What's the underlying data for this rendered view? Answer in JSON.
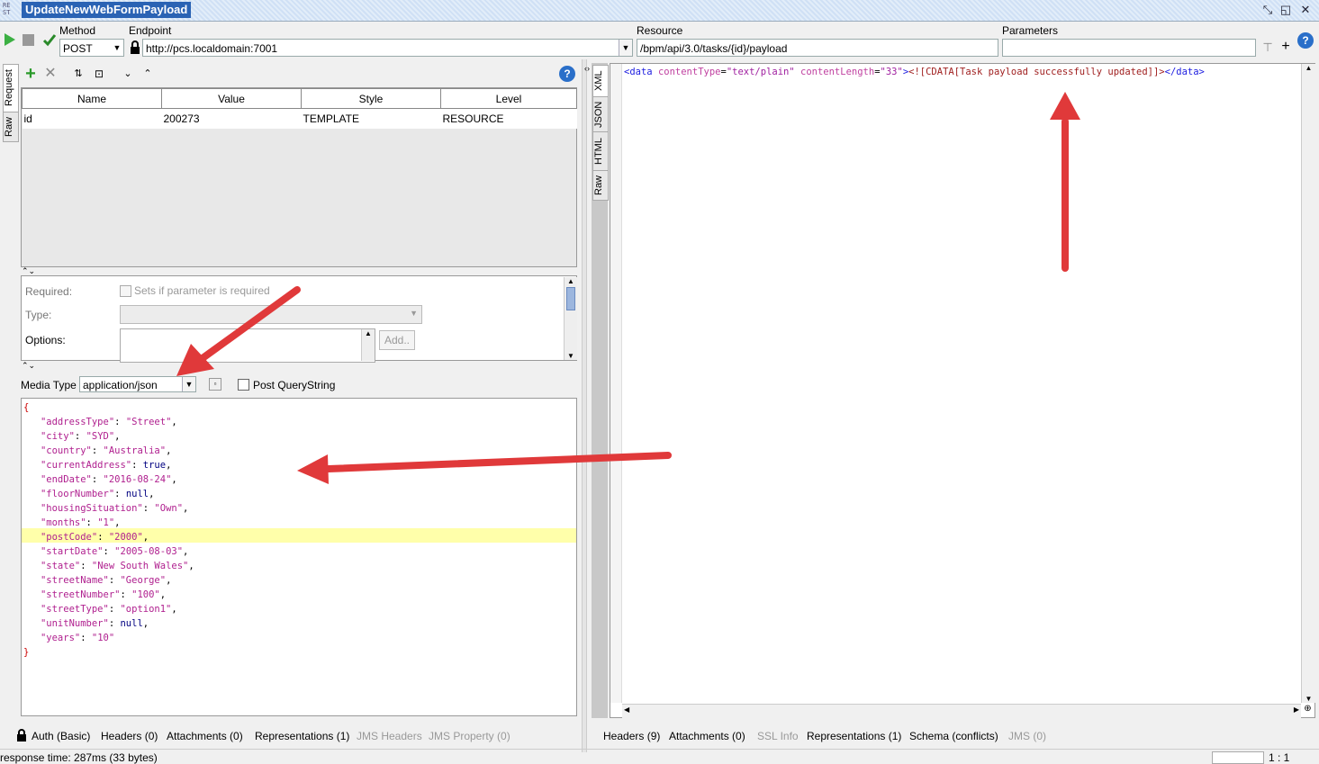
{
  "window": {
    "app_mark": "RE ST",
    "title": "UpdateNewWebFormPayload"
  },
  "toolbar": {
    "method_label": "Method",
    "method_value": "POST",
    "endpoint_label": "Endpoint",
    "endpoint_value": "http://pcs.localdomain:7001",
    "resource_label": "Resource",
    "resource_value": "/bpm/api/3.0/tasks/{id}/payload",
    "parameters_label": "Parameters",
    "parameters_value": ""
  },
  "request": {
    "side_tabs": [
      "Request",
      "Raw"
    ],
    "param_table": {
      "headers": [
        "Name",
        "Value",
        "Style",
        "Level"
      ],
      "rows": [
        [
          "id",
          "200273",
          "TEMPLATE",
          "RESOURCE"
        ]
      ]
    },
    "details": {
      "required_label": "Required:",
      "required_checkbox_label": "Sets if parameter is required",
      "type_label": "Type:",
      "options_label": "Options:",
      "add_button": "Add.."
    },
    "media_type_label": "Media Type",
    "media_type_value": "application/json",
    "post_querystring_label": "Post QueryString",
    "body_lines": [
      {
        "t": "{"
      },
      {
        "k": "addressType",
        "v": "\"Street\""
      },
      {
        "k": "city",
        "v": "\"SYD\""
      },
      {
        "k": "country",
        "v": "\"Australia\""
      },
      {
        "k": "currentAddress",
        "v": "true"
      },
      {
        "k": "endDate",
        "v": "\"2016-08-24\""
      },
      {
        "k": "floorNumber",
        "v": "null"
      },
      {
        "k": "housingSituation",
        "v": "\"Own\""
      },
      {
        "k": "months",
        "v": "\"1\""
      },
      {
        "k": "postCode",
        "v": "\"2000\""
      },
      {
        "k": "startDate",
        "v": "\"2005-08-03\""
      },
      {
        "k": "state",
        "v": "\"New South Wales\""
      },
      {
        "k": "streetName",
        "v": "\"George\""
      },
      {
        "k": "streetNumber",
        "v": "\"100\""
      },
      {
        "k": "streetType",
        "v": "\"option1\""
      },
      {
        "k": "unitNumber",
        "v": "null"
      },
      {
        "k": "years",
        "v": "\"10\"",
        "last": true
      },
      {
        "t": "}"
      }
    ],
    "bottom_tabs": [
      {
        "label": "Auth (Basic)",
        "enabled": true
      },
      {
        "label": "Headers (0)",
        "enabled": true
      },
      {
        "label": "Attachments (0)",
        "enabled": true
      },
      {
        "label": "Representations (1)",
        "enabled": true
      },
      {
        "label": "JMS Headers",
        "enabled": false
      },
      {
        "label": "JMS Property (0)",
        "enabled": false
      }
    ]
  },
  "response": {
    "side_tabs": [
      "XML",
      "JSON",
      "HTML",
      "Raw"
    ],
    "xml": {
      "tag_open": "<data",
      "attr1": "contentType",
      "val1": "\"text/plain\"",
      "attr2": "contentLength",
      "val2": "\"33\"",
      "close_bracket": ">",
      "cdata": "<![CDATA[Task payload successfully updated]]>",
      "tag_close": "</data>"
    },
    "bottom_tabs": [
      {
        "label": "Headers (9)",
        "enabled": true
      },
      {
        "label": "Attachments (0)",
        "enabled": true
      },
      {
        "label": "SSL Info",
        "enabled": false
      },
      {
        "label": "Representations (1)",
        "enabled": true
      },
      {
        "label": "Schema (conflicts)",
        "enabled": true
      },
      {
        "label": "JMS (0)",
        "enabled": false
      }
    ]
  },
  "status": {
    "response_time": "response time: 287ms (33 bytes)",
    "position": "1 : 1"
  },
  "colors": {
    "arrow": "#e0393a",
    "title_bg": "#2a63b4",
    "highlight_line": "#ffffaa"
  }
}
